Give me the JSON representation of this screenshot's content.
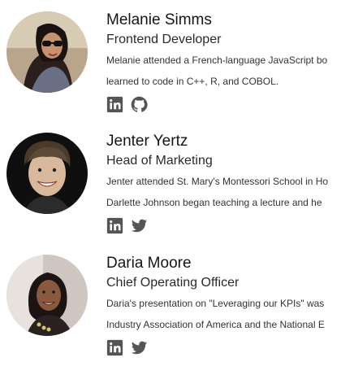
{
  "team": [
    {
      "name": "Melanie Simms",
      "title": "Frontend Developer",
      "bio_line1": "Melanie attended a French-language JavaScript bo",
      "bio_line2": "learned to code in C++, R, and COBOL.",
      "social": [
        "linkedin-icon",
        "github-icon"
      ]
    },
    {
      "name": "Jenter Yertz",
      "title": "Head of Marketing",
      "bio_line1": "Jenter attended St. Mary's Montessori School in Ho",
      "bio_line2": "Darlette Johnson began teaching a lecture and he",
      "social": [
        "linkedin-icon",
        "twitter-icon"
      ]
    },
    {
      "name": "Daria Moore",
      "title": "Chief Operating Officer",
      "bio_line1": "Daria's presentation on \"Leveraging our KPIs\" was",
      "bio_line2": "Industry Association of America and the National E",
      "social": [
        "linkedin-icon",
        "twitter-icon"
      ]
    }
  ],
  "colors": {
    "icon": "#555555",
    "text": "#222222"
  }
}
